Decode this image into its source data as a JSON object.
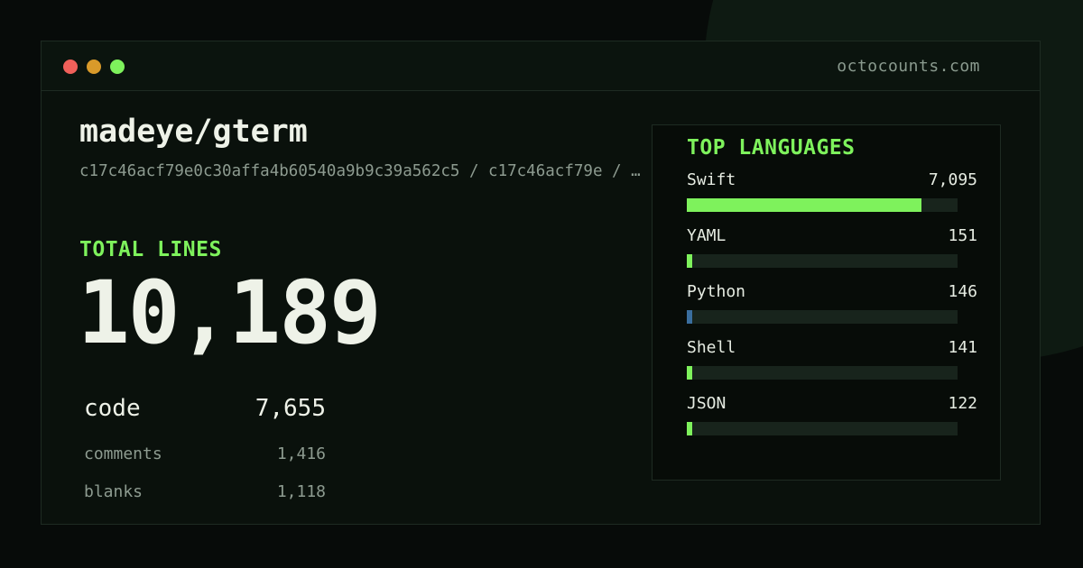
{
  "window": {
    "site": "octocounts.com",
    "controls": [
      {
        "name": "close",
        "color": "#f0605a"
      },
      {
        "name": "minimize",
        "color": "#d99a2a"
      },
      {
        "name": "maximize",
        "color": "#7ef25c"
      }
    ]
  },
  "repo": {
    "name": "madeye/gterm",
    "commit": "c17c46acf79e0c30affa4b60540a9b9c39a562c5 / c17c46acf79e / …"
  },
  "totals": {
    "label": "TOTAL LINES",
    "value": "10,189",
    "stats": [
      {
        "label": "code",
        "value": "7,655"
      },
      {
        "label": "comments",
        "value": "1,416"
      },
      {
        "label": "blanks",
        "value": "1,118"
      }
    ]
  },
  "languages": {
    "title": "TOP LANGUAGES",
    "items": [
      {
        "name": "Swift",
        "count": "7,095",
        "lines": 7095,
        "fraction": 0.866,
        "color": "#7ef25c"
      },
      {
        "name": "YAML",
        "count": "151",
        "lines": 151,
        "fraction": 0.02,
        "color": "#7ef25c"
      },
      {
        "name": "Python",
        "count": "146",
        "lines": 146,
        "fraction": 0.02,
        "color": "#3a6e9e"
      },
      {
        "name": "Shell",
        "count": "141",
        "lines": 141,
        "fraction": 0.02,
        "color": "#7ef25c"
      },
      {
        "name": "JSON",
        "count": "122",
        "lines": 122,
        "fraction": 0.02,
        "color": "#7ef25c"
      }
    ]
  },
  "colors": {
    "accent": "#7ef25c",
    "background": "#070b09",
    "text": "#eef2e8",
    "muted": "#8d9b90"
  }
}
